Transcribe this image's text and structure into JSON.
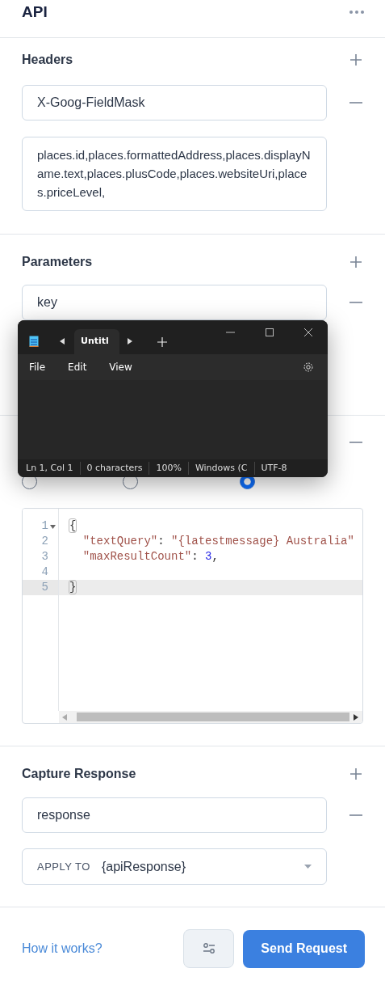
{
  "panel": {
    "title": "API"
  },
  "headers": {
    "title": "Headers",
    "key": "X-Goog-FieldMask",
    "value": "places.id,places.formattedAddress,places.displayName.text,places.plusCode,places.websiteUri,places.priceLevel,"
  },
  "parameters": {
    "title": "Parameters",
    "key": "key"
  },
  "body": {
    "options": [
      {
        "selected": false
      },
      {
        "selected": false
      },
      {
        "selected": true
      }
    ],
    "code_lines": [
      {
        "number": "1",
        "active": false,
        "foldable": true,
        "tokens": [
          {
            "kind": "bracket",
            "text": "{"
          }
        ]
      },
      {
        "number": "2",
        "active": false,
        "foldable": false,
        "tokens": [
          {
            "kind": "string",
            "text": "  \"textQuery\""
          },
          {
            "kind": "plain",
            "text": ": "
          },
          {
            "kind": "string",
            "text": "\"{latestmessage} Australia\""
          }
        ]
      },
      {
        "number": "3",
        "active": false,
        "foldable": false,
        "tokens": [
          {
            "kind": "string",
            "text": "  \"maxResultCount\""
          },
          {
            "kind": "plain",
            "text": ": "
          },
          {
            "kind": "number",
            "text": "3"
          },
          {
            "kind": "plain",
            "text": ","
          }
        ]
      },
      {
        "number": "4",
        "active": false,
        "foldable": false
      },
      {
        "number": "5",
        "active": true,
        "foldable": false,
        "tokens": [
          {
            "kind": "bracket",
            "text": "}"
          }
        ]
      }
    ]
  },
  "capture_response": {
    "title": "Capture Response",
    "variable": "response",
    "apply_to_label": "APPLY TO",
    "apply_to_value": "{apiResponse}"
  },
  "footer": {
    "help_link": "How it works?",
    "send_button": "Send Request"
  },
  "notepad": {
    "tab_title": "Untitl",
    "menus": [
      "File",
      "Edit",
      "View"
    ],
    "status": [
      "Ln 1, Col 1",
      "0 characters",
      "100%",
      "Windows (C",
      "UTF-8"
    ]
  }
}
